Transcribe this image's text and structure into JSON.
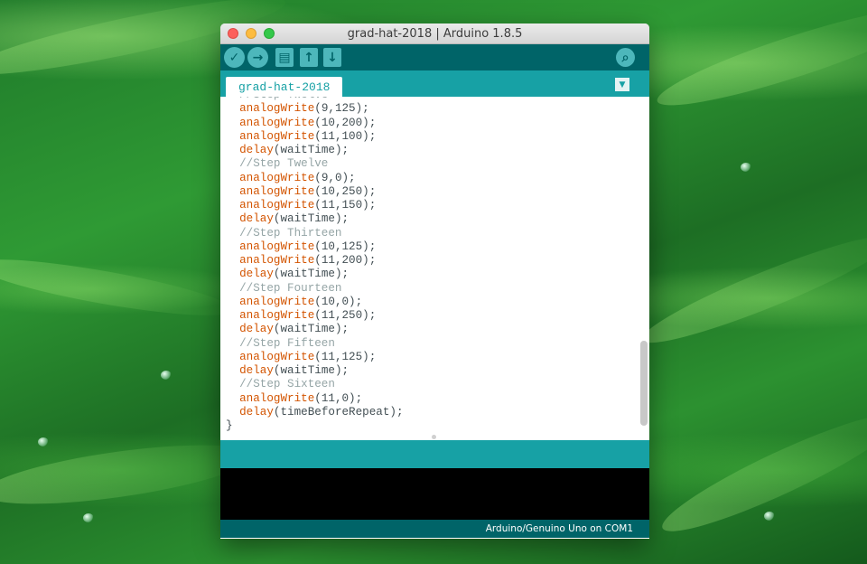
{
  "window": {
    "title": "grad-hat-2018 | Arduino 1.8.5"
  },
  "toolbar": {
    "buttons": [
      {
        "name": "verify",
        "icon": "check-icon",
        "glyph": "✓"
      },
      {
        "name": "upload",
        "icon": "arrow-right-icon",
        "glyph": "→"
      },
      {
        "name": "new",
        "icon": "new-file-icon",
        "glyph": "▤"
      },
      {
        "name": "open",
        "icon": "open-up-arrow-icon",
        "glyph": "↑"
      },
      {
        "name": "save",
        "icon": "save-down-arrow-icon",
        "glyph": "↓"
      },
      {
        "name": "serial-monitor",
        "icon": "magnifier-icon",
        "glyph": "⌕"
      }
    ]
  },
  "tabs": [
    {
      "label": "grad-hat-2018"
    }
  ],
  "tab_menu_glyph": "▼",
  "code_lines": [
    {
      "parts": [
        {
          "t": "  //Step Twelve",
          "c": "cm"
        }
      ]
    },
    {
      "parts": [
        {
          "t": "  "
        },
        {
          "t": "analogWrite",
          "c": "kw"
        },
        {
          "t": "(9,125);"
        }
      ]
    },
    {
      "parts": [
        {
          "t": "  "
        },
        {
          "t": "analogWrite",
          "c": "kw"
        },
        {
          "t": "(10,200);"
        }
      ]
    },
    {
      "parts": [
        {
          "t": "  "
        },
        {
          "t": "analogWrite",
          "c": "kw"
        },
        {
          "t": "(11,100);"
        }
      ]
    },
    {
      "parts": [
        {
          "t": "  "
        },
        {
          "t": "delay",
          "c": "kw"
        },
        {
          "t": "(waitTime);"
        }
      ]
    },
    {
      "parts": [
        {
          "t": "  //Step Twelve",
          "c": "cm"
        }
      ]
    },
    {
      "parts": [
        {
          "t": "  "
        },
        {
          "t": "analogWrite",
          "c": "kw"
        },
        {
          "t": "(9,0);"
        }
      ]
    },
    {
      "parts": [
        {
          "t": "  "
        },
        {
          "t": "analogWrite",
          "c": "kw"
        },
        {
          "t": "(10,250);"
        }
      ]
    },
    {
      "parts": [
        {
          "t": "  "
        },
        {
          "t": "analogWrite",
          "c": "kw"
        },
        {
          "t": "(11,150);"
        }
      ]
    },
    {
      "parts": [
        {
          "t": "  "
        },
        {
          "t": "delay",
          "c": "kw"
        },
        {
          "t": "(waitTime);"
        }
      ]
    },
    {
      "parts": [
        {
          "t": "  //Step Thirteen",
          "c": "cm"
        }
      ]
    },
    {
      "parts": [
        {
          "t": "  "
        },
        {
          "t": "analogWrite",
          "c": "kw"
        },
        {
          "t": "(10,125);"
        }
      ]
    },
    {
      "parts": [
        {
          "t": "  "
        },
        {
          "t": "analogWrite",
          "c": "kw"
        },
        {
          "t": "(11,200);"
        }
      ]
    },
    {
      "parts": [
        {
          "t": "  "
        },
        {
          "t": "delay",
          "c": "kw"
        },
        {
          "t": "(waitTime);"
        }
      ]
    },
    {
      "parts": [
        {
          "t": "  //Step Fourteen",
          "c": "cm"
        }
      ]
    },
    {
      "parts": [
        {
          "t": "  "
        },
        {
          "t": "analogWrite",
          "c": "kw"
        },
        {
          "t": "(10,0);"
        }
      ]
    },
    {
      "parts": [
        {
          "t": "  "
        },
        {
          "t": "analogWrite",
          "c": "kw"
        },
        {
          "t": "(11,250);"
        }
      ]
    },
    {
      "parts": [
        {
          "t": "  "
        },
        {
          "t": "delay",
          "c": "kw"
        },
        {
          "t": "(waitTime);"
        }
      ]
    },
    {
      "parts": [
        {
          "t": "  //Step Fifteen",
          "c": "cm"
        }
      ]
    },
    {
      "parts": [
        {
          "t": "  "
        },
        {
          "t": "analogWrite",
          "c": "kw"
        },
        {
          "t": "(11,125);"
        }
      ]
    },
    {
      "parts": [
        {
          "t": "  "
        },
        {
          "t": "delay",
          "c": "kw"
        },
        {
          "t": "(waitTime);"
        }
      ]
    },
    {
      "parts": [
        {
          "t": "  //Step Sixteen",
          "c": "cm"
        }
      ]
    },
    {
      "parts": [
        {
          "t": "  "
        },
        {
          "t": "analogWrite",
          "c": "kw"
        },
        {
          "t": "(11,0);"
        }
      ]
    },
    {
      "parts": [
        {
          "t": "  "
        },
        {
          "t": "delay",
          "c": "kw"
        },
        {
          "t": "(timeBeforeRepeat);"
        }
      ]
    },
    {
      "parts": [
        {
          "t": "}"
        }
      ]
    }
  ],
  "status": {
    "board": "Arduino/Genuino Uno on COM1"
  },
  "colors": {
    "toolbar": "#006468",
    "tabbar": "#17a1a5",
    "keyword": "#d35400",
    "comment": "#95a5a6",
    "text": "#434f54"
  }
}
